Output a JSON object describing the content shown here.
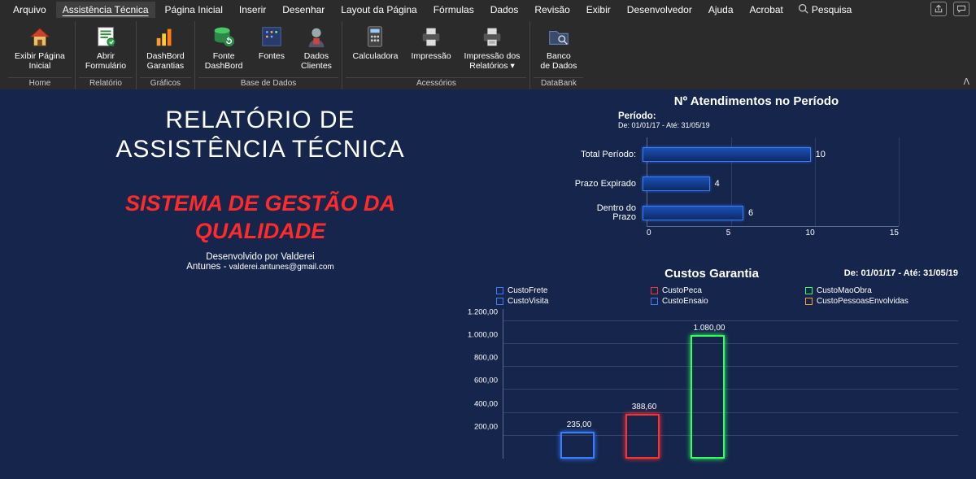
{
  "menu": {
    "items": [
      "Arquivo",
      "Assistência Técnica",
      "Página Inicial",
      "Inserir",
      "Desenhar",
      "Layout da Página",
      "Fórmulas",
      "Dados",
      "Revisão",
      "Exibir",
      "Desenvolvedor",
      "Ajuda",
      "Acrobat"
    ],
    "active_index": 1,
    "search_label": "Pesquisa"
  },
  "ribbon": {
    "groups": [
      {
        "label": "Home",
        "buttons": [
          {
            "id": "home-icon",
            "label": "Exibir Página\nInicial"
          }
        ]
      },
      {
        "label": "Relatório",
        "buttons": [
          {
            "id": "form-icon",
            "label": "Abrir\nFormulário"
          }
        ]
      },
      {
        "label": "Gráficos",
        "buttons": [
          {
            "id": "dash-icon",
            "label": "DashBord\nGarantias"
          }
        ]
      },
      {
        "label": "Base de Dados",
        "buttons": [
          {
            "id": "dbfont-icon",
            "label": "Fonte\nDashBord"
          },
          {
            "id": "fonts-icon",
            "label": "Fontes"
          },
          {
            "id": "clients-icon",
            "label": "Dados\nClientes"
          }
        ]
      },
      {
        "label": "Acessórios",
        "buttons": [
          {
            "id": "calc-icon",
            "label": "Calculadora"
          },
          {
            "id": "print-icon",
            "label": "Impressão"
          },
          {
            "id": "printrep-icon",
            "label": "Impressão dos\nRelatórios",
            "dropdown": true
          }
        ]
      },
      {
        "label": "DataBank",
        "buttons": [
          {
            "id": "bank-icon",
            "label": "Banco\nde Dados"
          }
        ]
      }
    ]
  },
  "report": {
    "title_line1": "RELATÓRIO DE",
    "title_line2": "ASSISTÊNCIA TÉCNICA",
    "subtitle_line1": "SISTEMA DE GESTÃO DA",
    "subtitle_line2": "QUALIDADE",
    "developer": "Desenvolvido por Valderei",
    "author": "Antunes - ",
    "email": "valderei.antunes@gmail.com"
  },
  "chart1": {
    "title": "Nº Atendimentos no Período",
    "period_label": "Período:",
    "period_value": "De: 01/01/17 - Até: 31/05/19"
  },
  "chart2": {
    "title": "Custos Garantia",
    "period": "De: 01/01/17 - Até: 31/05/19"
  },
  "chart_data": [
    {
      "type": "bar",
      "orientation": "horizontal",
      "title": "Nº Atendimentos no Período",
      "categories": [
        "Total Período:",
        "Prazo Expirado",
        "Dentro do Prazo"
      ],
      "values": [
        10,
        4,
        6
      ],
      "xlim": [
        0,
        15
      ],
      "xticks": [
        0,
        5,
        10,
        15
      ],
      "xlabel": "",
      "ylabel": ""
    },
    {
      "type": "bar",
      "orientation": "vertical",
      "title": "Custos Garantia",
      "series": [
        {
          "name": "CustoFrete",
          "color": "#3a7bff",
          "values": [
            235.0
          ]
        },
        {
          "name": "CustoPeca",
          "color": "#ff3030",
          "values": [
            388.6
          ]
        },
        {
          "name": "CustoMaoObra",
          "color": "#30ff60",
          "values": [
            1080.0
          ]
        },
        {
          "name": "CustoVisita",
          "color": "#3a7bff",
          "values": [
            0
          ]
        },
        {
          "name": "CustoEnsaio",
          "color": "#3a7bff",
          "values": [
            0
          ]
        },
        {
          "name": "CustoPessoasEnvolvidas",
          "color": "#ff9a30",
          "values": [
            0
          ]
        }
      ],
      "ylim": [
        0,
        1200
      ],
      "yticks": [
        200,
        400,
        600,
        800,
        1000,
        1200
      ],
      "ytick_labels": [
        "200,00",
        "400,00",
        "600,00",
        "800,00",
        "1.000,00",
        "1.200,00"
      ],
      "value_labels": [
        "235,00",
        "388,60",
        "1.080,00"
      ],
      "xlabel": "",
      "ylabel": ""
    }
  ]
}
